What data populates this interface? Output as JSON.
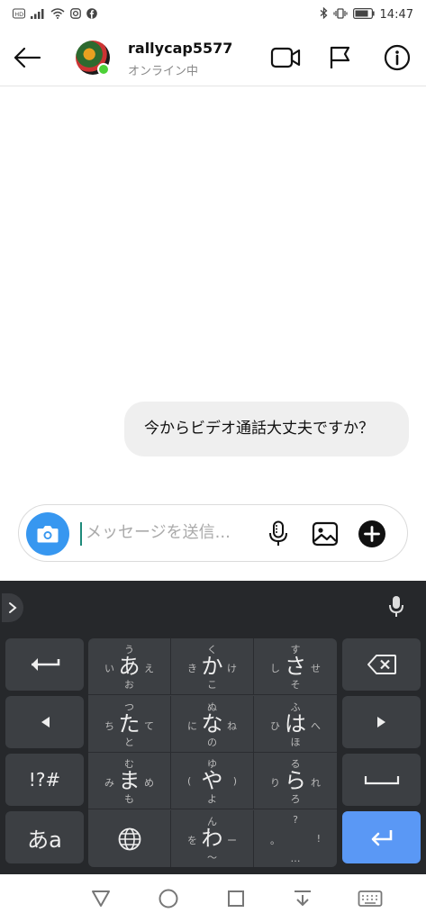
{
  "status_bar": {
    "time": "14:47",
    "left_icons": [
      "hd-icon",
      "signal-icon",
      "wifi-icon",
      "instagram-icon",
      "facebook-icon"
    ],
    "right_icons": [
      "bluetooth-icon",
      "vibrate-icon",
      "battery-icon"
    ]
  },
  "header": {
    "username": "rallycap5577",
    "status": "オンライン中"
  },
  "messages": [
    {
      "sender": "me",
      "text": "今からビデオ通話大丈夫ですか？"
    }
  ],
  "composer": {
    "placeholder": "メッセージを送信..."
  },
  "keyboard": {
    "rows": [
      [
        {
          "main": "あ",
          "up": "う",
          "left": "い",
          "right": "え",
          "down": "お"
        },
        {
          "main": "か",
          "up": "く",
          "left": "き",
          "right": "け",
          "down": "こ"
        },
        {
          "main": "さ",
          "up": "す",
          "left": "し",
          "right": "せ",
          "down": "そ"
        }
      ],
      [
        {
          "main": "た",
          "up": "つ",
          "left": "ち",
          "right": "て",
          "down": "と"
        },
        {
          "main": "な",
          "up": "ぬ",
          "left": "に",
          "right": "ね",
          "down": "の"
        },
        {
          "main": "は",
          "up": "ふ",
          "left": "ひ",
          "right": "へ",
          "down": "ほ"
        }
      ],
      [
        {
          "main": "ま",
          "up": "む",
          "left": "み",
          "right": "め",
          "down": "も"
        },
        {
          "main": "や",
          "up": "ゆ",
          "left": "(",
          "right": ")",
          "down": "よ"
        },
        {
          "main": "ら",
          "up": "る",
          "left": "り",
          "right": "れ",
          "down": "ろ"
        }
      ],
      [
        {
          "main": "",
          "up": "",
          "left": "",
          "right": "",
          "down": ""
        },
        {
          "main": "わ",
          "up": "ん",
          "left": "を",
          "right": "ー",
          "down": "〜"
        },
        {
          "main": "",
          "up": "?",
          "left": "。",
          "right": "!",
          "down": "…"
        }
      ]
    ],
    "symbols_label": "!?#",
    "mode_label": "あa",
    "accent_color": "#5a98f5"
  }
}
